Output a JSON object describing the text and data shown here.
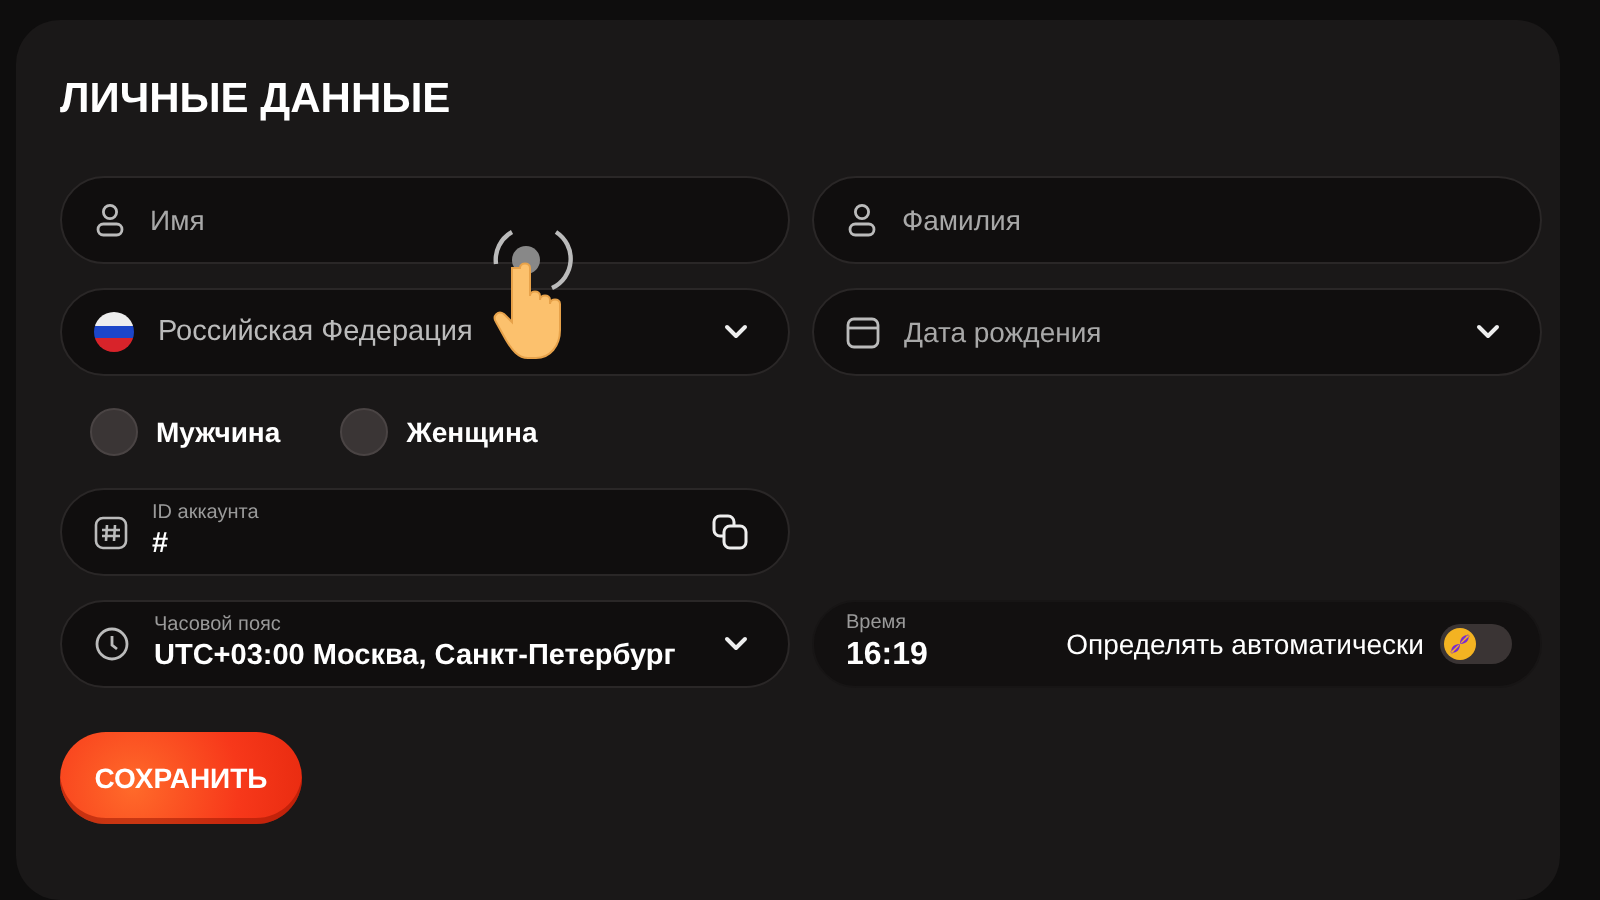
{
  "title": "ЛИЧНЫЕ ДАННЫЕ",
  "fields": [
    {
      "kind": "text",
      "placeholder": "Имя"
    },
    {
      "kind": "text",
      "placeholder": "Фамилия"
    },
    {
      "kind": "select",
      "value": "Российская Федерация"
    },
    {
      "kind": "select",
      "placeholder": "Дата рождения"
    }
  ],
  "gender": [
    {
      "label": "Мужчина",
      "selected": false
    },
    {
      "label": "Женщина",
      "selected": false
    }
  ],
  "account_id": {
    "label": "ID аккаунта",
    "value": "#"
  },
  "timezone": {
    "label": "Часовой пояс",
    "value": "UTC+03:00 Москва, Санкт-Петербург"
  },
  "time": {
    "label": "Время",
    "value": "16:19",
    "auto_label": "Определять автоматически",
    "auto": false
  },
  "save_button": "СОХРАНИТЬ"
}
